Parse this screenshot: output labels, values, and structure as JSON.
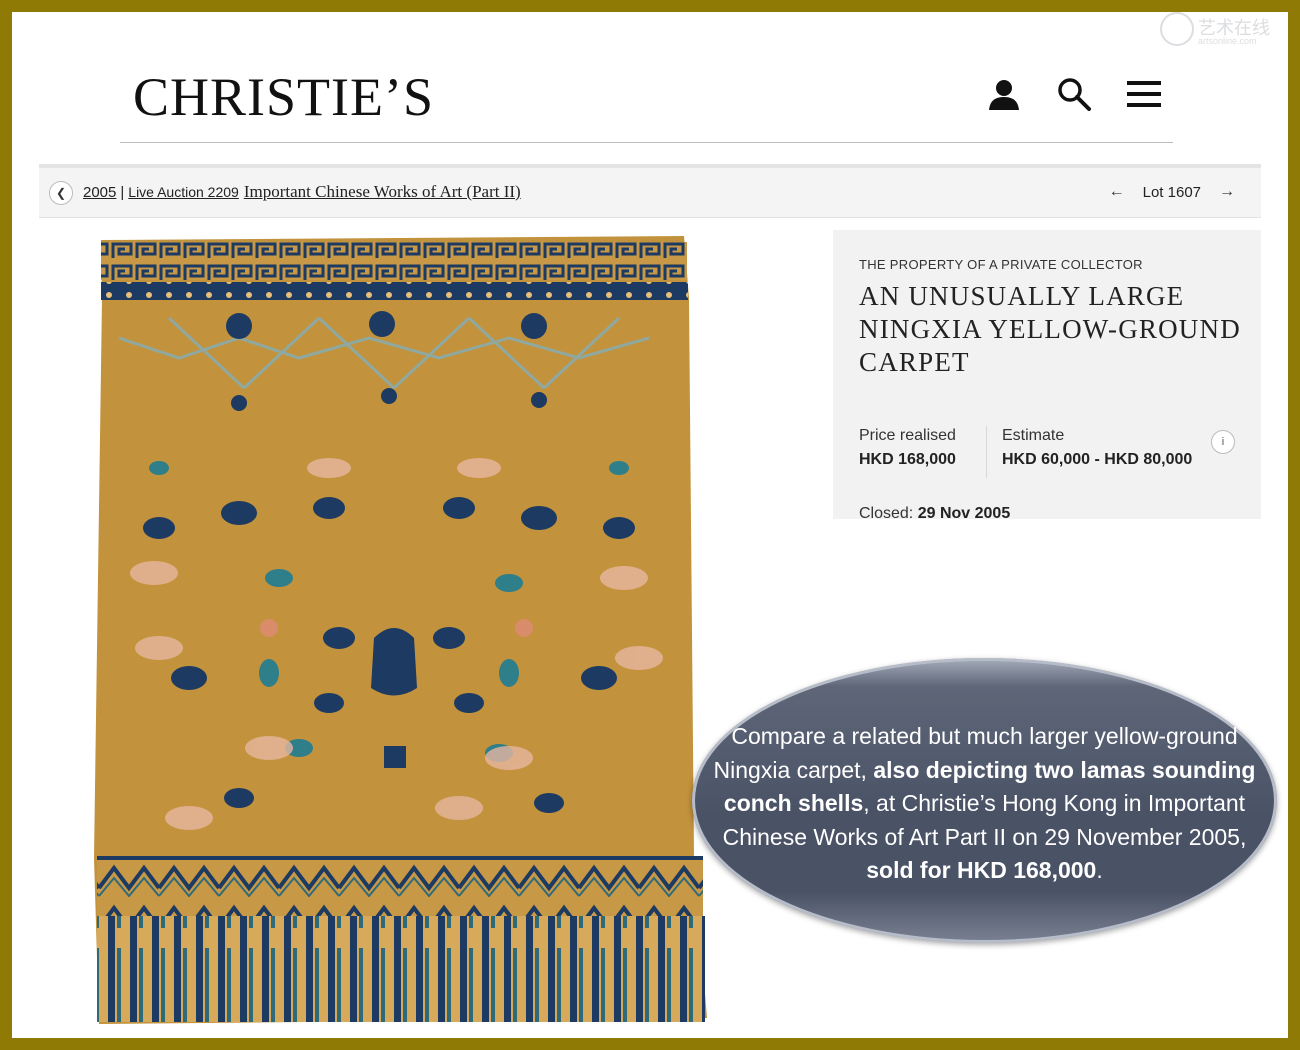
{
  "header": {
    "logo": "CHRISTIE’S",
    "icons": [
      "account-icon",
      "search-icon",
      "menu-icon"
    ]
  },
  "breadcrumb": {
    "year": "2005",
    "separator": "|",
    "live_auction": "Live Auction 2209",
    "sale_title": "Important Chinese Works of Art (Part II)"
  },
  "lot_nav": {
    "lot_label": "Lot 1607"
  },
  "lot": {
    "provenance": "THE PROPERTY OF A PRIVATE COLLECTOR",
    "title": "AN UNUSUALLY LARGE NINGXIA YELLOW-GROUND CARPET",
    "price_realised_label": "Price realised",
    "price_realised": "HKD 168,000",
    "estimate_label": "Estimate",
    "estimate": "HKD 60,000 - HKD 80,000",
    "info": "i",
    "closed_label": "Closed:",
    "closed_date": "29 Nov 2005"
  },
  "callout": {
    "p1": "Compare a related but much larger yellow-ground Ningxia carpet, ",
    "p2": "also depicting two lamas sounding conch shells",
    "p3": ", at Christie’s Hong Kong in Important Chinese Works of Art Part II on 29 November 2005,",
    "p4": "sold for HKD 168,000",
    "p5": "."
  },
  "watermark": {
    "text": "艺术在线",
    "sub": "artsonline.com"
  },
  "colors": {
    "frame": "#8f7a06",
    "carpet_ground": "#c2923c",
    "carpet_blue": "#1c3a62",
    "callout": "#4a5266"
  }
}
